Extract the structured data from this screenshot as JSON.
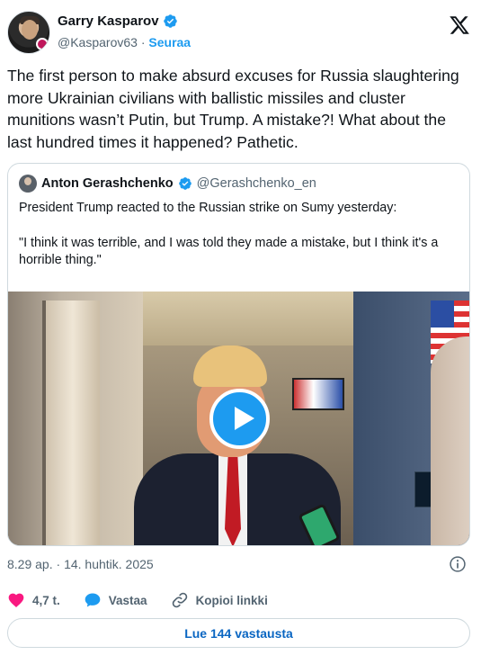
{
  "author": {
    "name": "Garry Kasparov",
    "handle": "@Kasparov63",
    "separator": "·",
    "follow_label": "Seuraa"
  },
  "tweet": {
    "text": "The first person to make absurd excuses for Russia slaughtering more Ukrainian civilians with ballistic missiles and cluster munitions wasn’t Putin, but Trump. A mistake?! What about the last hundred times it happened? Pathetic."
  },
  "quote": {
    "name": "Anton Gerashchenko",
    "handle": "@Gerashchenko_en",
    "text_line1": "President Trump reacted to the Russian strike on Sumy yesterday:",
    "text_line2": "\"I think it was terrible, and I was told they made a mistake, but I think it's a horrible thing.\""
  },
  "meta": {
    "time": "8.29 ap.",
    "separator": "·",
    "date": "14. huhtik. 2025"
  },
  "actions": {
    "likes": "4,7 t.",
    "reply_label": "Vastaa",
    "copy_link_label": "Kopioi linkki"
  },
  "replies_button": "Lue 144 vastausta",
  "colors": {
    "accent": "#1d9bf0",
    "like": "#f91880",
    "text": "#0f1419",
    "muted": "#536471"
  },
  "icons": [
    "verified-badge-icon",
    "x-logo-icon",
    "play-icon",
    "info-icon",
    "heart-icon",
    "reply-icon",
    "link-icon"
  ]
}
